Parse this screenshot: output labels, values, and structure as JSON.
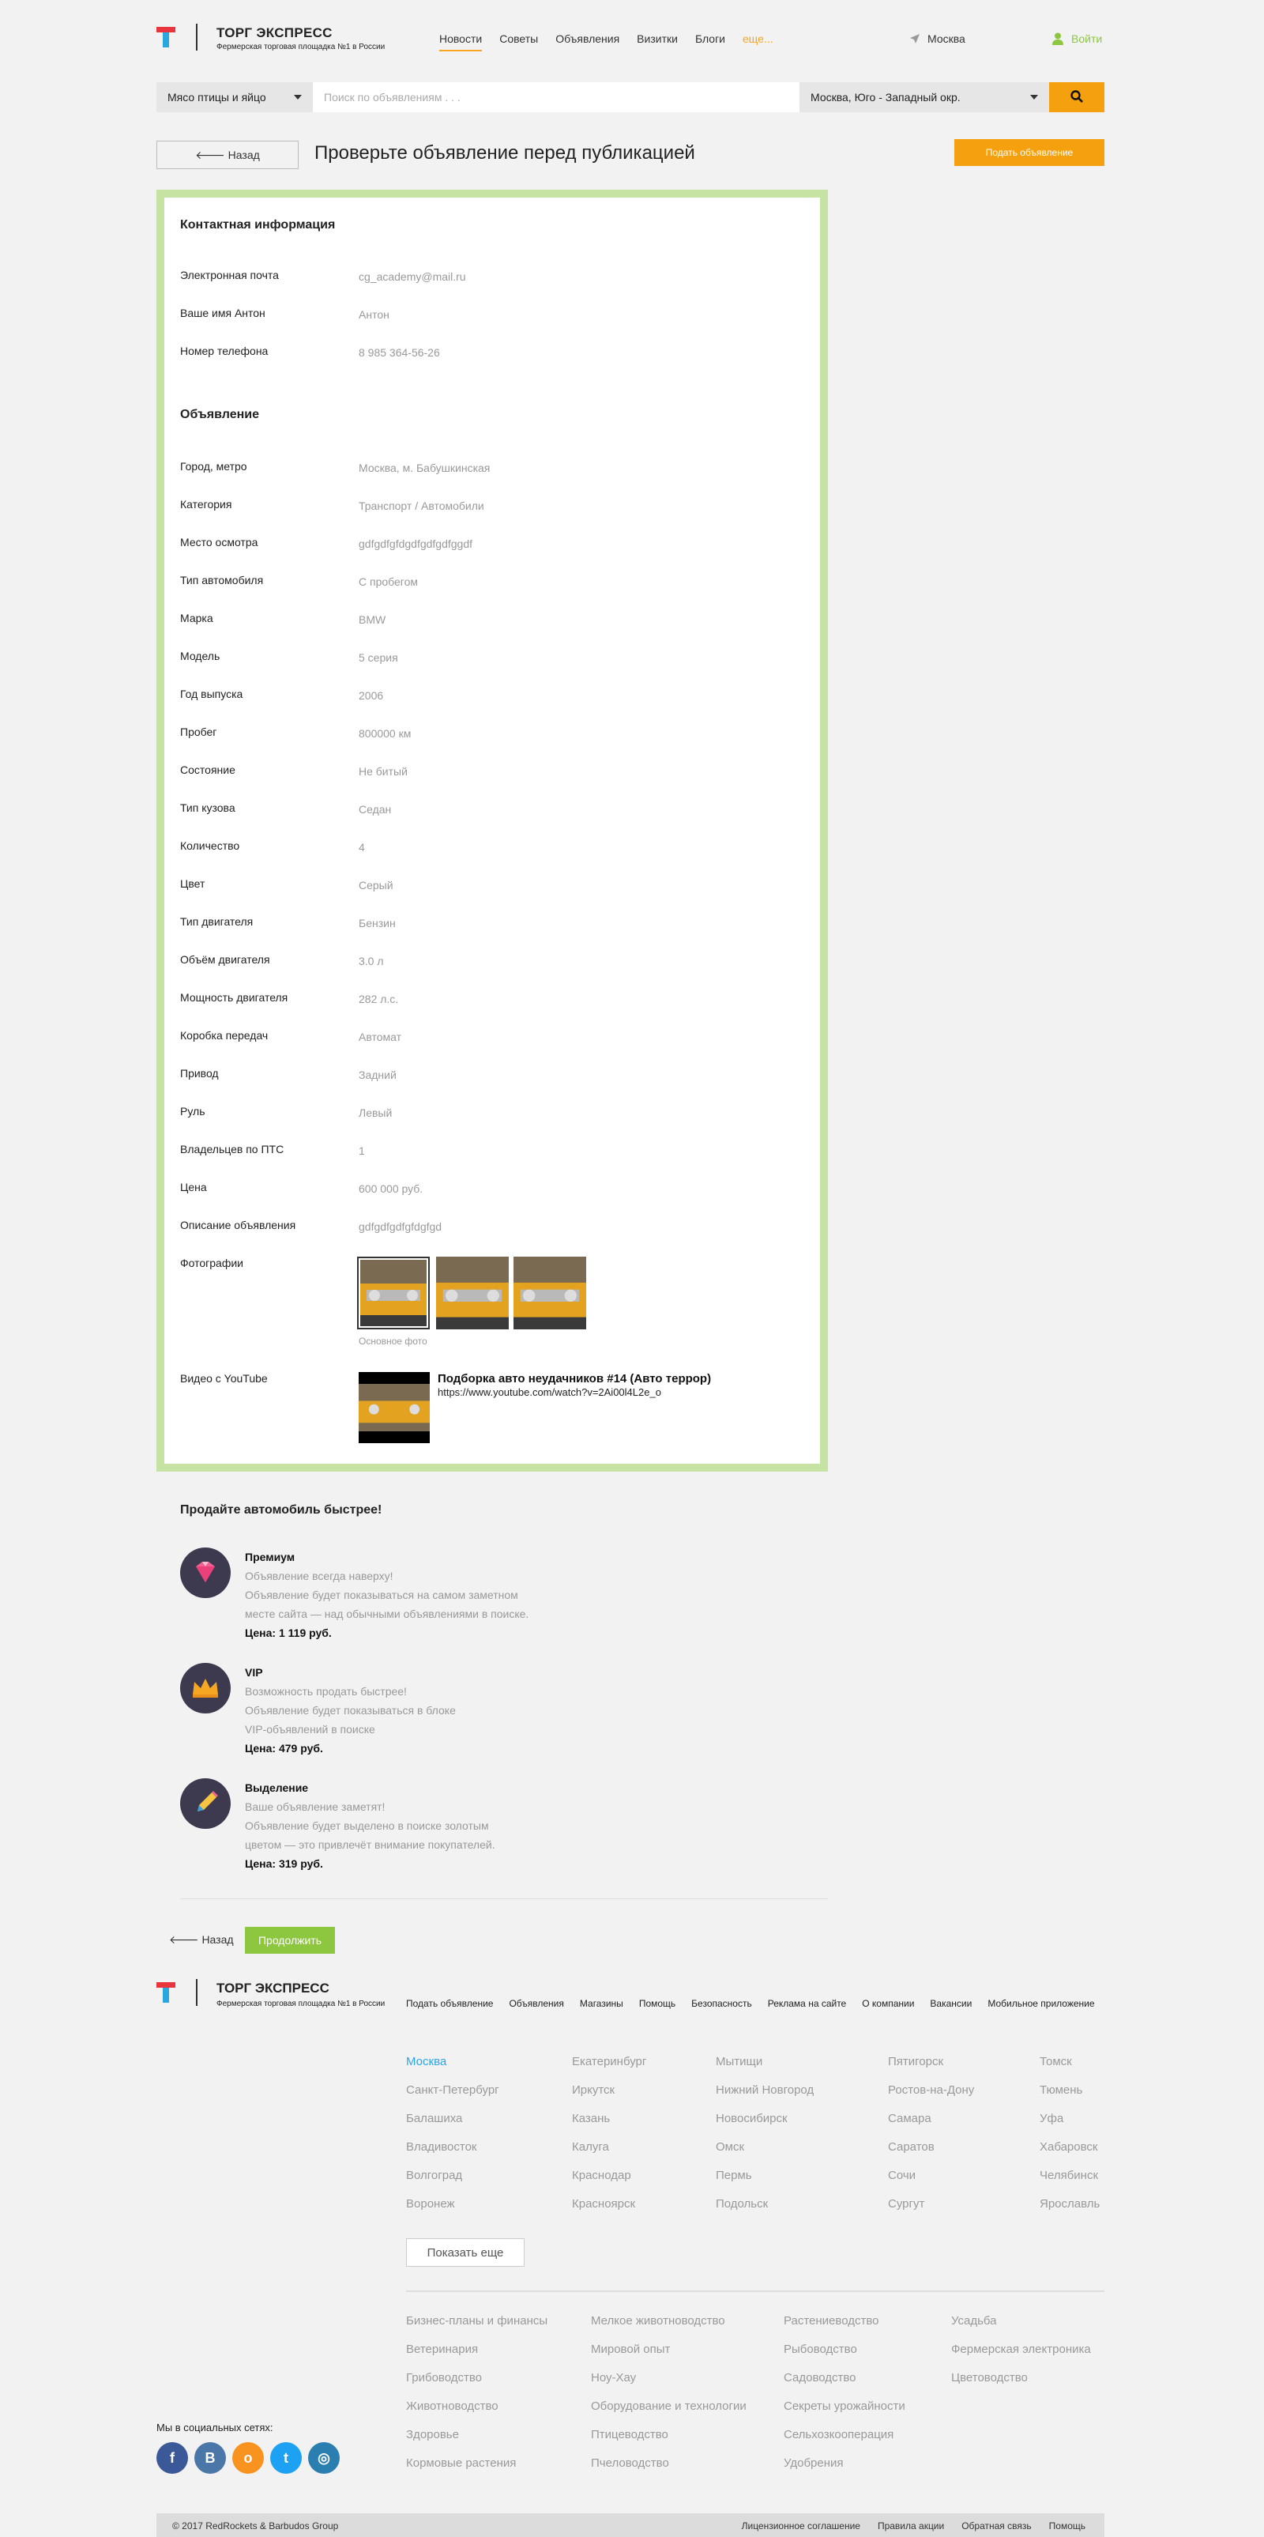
{
  "header": {
    "brand_title": "ТОРГ ЭКСПРЕСС",
    "brand_subtitle": "Фермерская торговая площадка №1 в России",
    "nav": [
      "Новости",
      "Советы",
      "Объявления",
      "Визитки",
      "Блоги",
      "еще..."
    ],
    "city": "Москва",
    "login": "Войти",
    "colors": {
      "accent": "#f5a00f",
      "green": "#8dc63f",
      "card_border": "#c7e3a3"
    }
  },
  "search": {
    "category": "Мясо птицы и яйцо",
    "placeholder": "Поиск по объявлениям . . .",
    "location": "Москва, Юго - Западный окр."
  },
  "page": {
    "back_label": "Назад",
    "title": "Проверьте объявление перед публикацией",
    "submit_label": "Подать объявление"
  },
  "contact": {
    "title": "Контактная информация",
    "rows": [
      {
        "label": "Электронная почта",
        "value": "cg_academy@mail.ru"
      },
      {
        "label": "Ваше имя Антон",
        "value": "Антон"
      },
      {
        "label": "Номер телефона",
        "value": "8 985 364-56-26"
      }
    ]
  },
  "ad": {
    "title": "Объявление",
    "rows": [
      {
        "label": "Город, метро",
        "value": "Москва, м. Бабушкинская"
      },
      {
        "label": "Категория",
        "value": "Транспорт / Автомобили"
      },
      {
        "label": "Место осмотра",
        "value": "gdfgdfgfdgdfgdfgdfggdf"
      },
      {
        "label": "Тип автомобиля",
        "value": "С пробегом"
      },
      {
        "label": "Марка",
        "value": "BMW"
      },
      {
        "label": "Модель",
        "value": "5 серия"
      },
      {
        "label": "Год выпуска",
        "value": "2006"
      },
      {
        "label": "Пробег",
        "value": "800000 км"
      },
      {
        "label": "Состояние",
        "value": "Не битый"
      },
      {
        "label": "Тип кузова",
        "value": "Седан"
      },
      {
        "label": "Количество",
        "value": "4"
      },
      {
        "label": "Цвет",
        "value": "Серый"
      },
      {
        "label": "Тип двигателя",
        "value": "Бензин"
      },
      {
        "label": "Объём двигателя",
        "value": "3.0 л"
      },
      {
        "label": "Мощность двигателя",
        "value": "282 л.с."
      },
      {
        "label": "Коробка передач",
        "value": "Автомат"
      },
      {
        "label": "Привод",
        "value": "Задний"
      },
      {
        "label": "Руль",
        "value": "Левый"
      },
      {
        "label": "Владельцев по ПТС",
        "value": "1"
      },
      {
        "label": "Цена",
        "value": "600 000 руб."
      },
      {
        "label": "Описание объявления",
        "value": "gdfgdfgdfgfdgfgd"
      }
    ],
    "photos_label": "Фотографии",
    "photos_caption": "Основное фото",
    "video_label": "Видео с YouTube",
    "video_title": "Подборка авто неудачников #14 (Авто террор)",
    "video_url": "https://www.youtube.com/watch?v=2Ai00l4L2e_o"
  },
  "promo": {
    "title": "Продайте автомобиль быстрее!",
    "items": [
      {
        "icon": "diamond-icon",
        "name": "Премиум",
        "lines": [
          "Объявление всегда наверху!",
          "Объявление будет показываться на самом заметном",
          "месте сайта — над обычными объявлениями в поиске."
        ],
        "price": "Цена: 1 119 руб."
      },
      {
        "icon": "crown-icon",
        "name": "VIP",
        "lines": [
          "Возможность продать быстрее!",
          "Объявление будет показываться в блоке",
          "VIP-объявлений в поиске"
        ],
        "price": "Цена: 479 руб."
      },
      {
        "icon": "pencil-icon",
        "name": "Выделение",
        "lines": [
          "Ваше объявление заметят!",
          "Объявление будет выделено в поиске золотым",
          "цветом — это привлечёт внимание покупателей."
        ],
        "price": "Цена: 319 руб."
      }
    ]
  },
  "actions": {
    "back": "Назад",
    "continue": "Продолжить"
  },
  "footer": {
    "brand_title": "ТОРГ ЭКСПРЕСС",
    "brand_subtitle": "Фермерская торговая площадка №1 в России",
    "nav": [
      "Подать объявление",
      "Объявления",
      "Магазины",
      "Помощь",
      "Безопасность",
      "Реклама на сайте",
      "О компании",
      "Вакансии",
      "Мобильное приложение"
    ],
    "cities": [
      [
        "Москва",
        "Санкт-Петербург",
        "Балашиха",
        "Владивосток",
        "Волгоград",
        "Воронеж"
      ],
      [
        "Екатеринбург",
        "Иркутск",
        "Казань",
        "Калуга",
        "Краснодар",
        "Красноярск"
      ],
      [
        "Мытищи",
        "Нижний Новгород",
        "Новосибирск",
        "Омск",
        "Пермь",
        "Подольск"
      ],
      [
        "Пятигорск",
        "Ростов-на-Дону",
        "Самара",
        "Саратов",
        "Сочи",
        "Сургут"
      ],
      [
        "Томск",
        "Тюмень",
        "Уфа",
        "Хабаровск",
        "Челябинск",
        "Ярославль"
      ]
    ],
    "show_more": "Показать еще",
    "topics": [
      [
        "Бизнес-планы и финансы",
        "Ветеринария",
        "Грибоводство",
        "Животноводство",
        "Здоровье",
        "Кормовые растения"
      ],
      [
        "Мелкое животноводство",
        "Мировой опыт",
        "Ноу-Хау",
        "Оборудование и технологии",
        "Птицеводство",
        "Пчеловодство"
      ],
      [
        "Растениеводство",
        "Рыбоводство",
        "Садоводство",
        "Секреты урожайности",
        "Сельхозкооперация",
        "Удобрения"
      ],
      [
        "Усадьба",
        "Фермерская электроника",
        "Цветоводство"
      ]
    ],
    "social_label": "Мы в социальных сетях:",
    "social": [
      {
        "icon": "facebook-icon",
        "glyph": "f",
        "color": "#3b5998"
      },
      {
        "icon": "vk-icon",
        "glyph": "В",
        "color": "#4a76a8"
      },
      {
        "icon": "odnoklassniki-icon",
        "glyph": "о",
        "color": "#f7931e"
      },
      {
        "icon": "twitter-icon",
        "glyph": "t",
        "color": "#1da1f2"
      },
      {
        "icon": "instagram-icon",
        "glyph": "◎",
        "color": "#2a7fb0"
      }
    ],
    "copyright": "© 2017 RedRockets & Barbudos Group",
    "legal": [
      "Лицензионное соглашение",
      "Правила акции",
      "Обратная связь",
      "Помощь"
    ]
  }
}
